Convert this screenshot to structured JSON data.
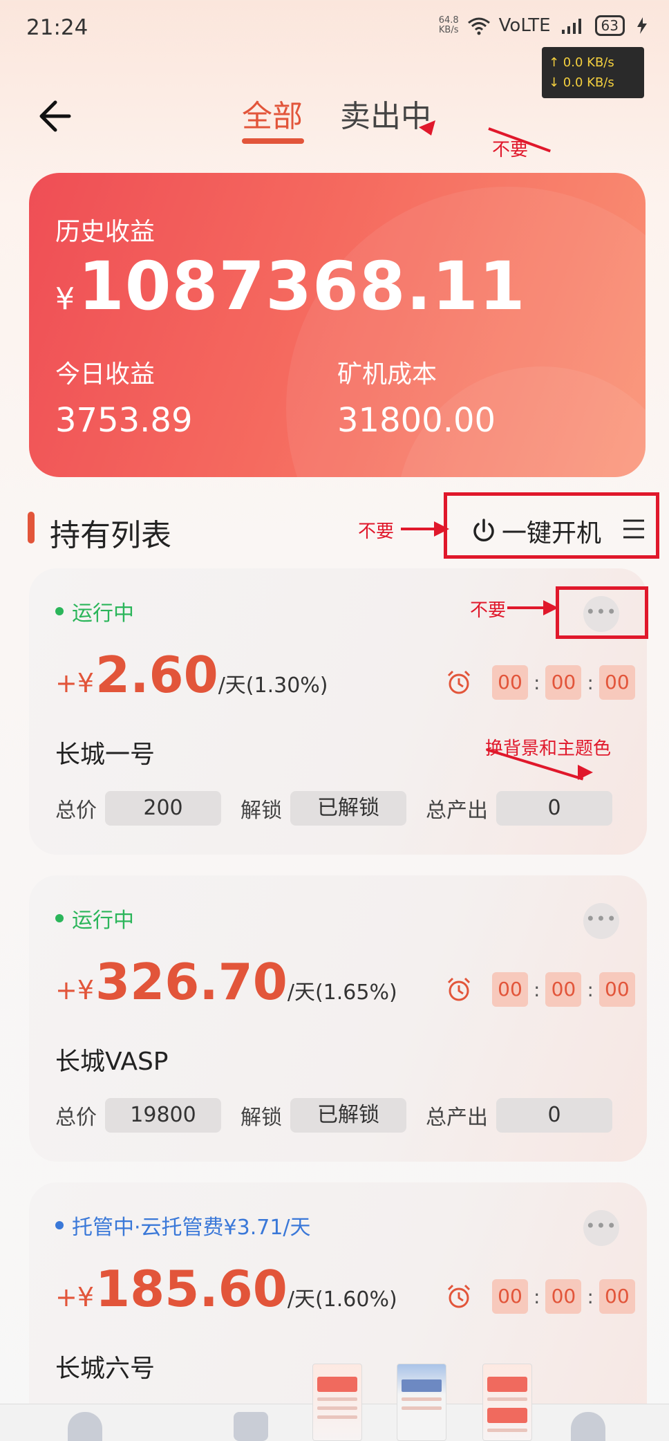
{
  "status_bar": {
    "time": "21:24",
    "speed_value": "64.8",
    "speed_unit": "KB/s",
    "network": "VoLTE",
    "battery": "63",
    "upload": "↑ 0.0 KB/s",
    "download": "↓ 0.0 KB/s"
  },
  "header": {
    "tabs": [
      {
        "label": "全部",
        "active": true
      },
      {
        "label": "卖出中",
        "active": false
      }
    ]
  },
  "summary": {
    "history_label": "历史收益",
    "currency": "¥",
    "history_value": "1087368.11",
    "today_label": "今日收益",
    "today_value": "3753.89",
    "cost_label": "矿机成本",
    "cost_value": "31800.00"
  },
  "list": {
    "title": "持有列表",
    "one_key_label": "一键开机"
  },
  "items": [
    {
      "status": "运行中",
      "status_color": "#2bb55a",
      "sign": "+¥",
      "amount": "2.60",
      "per": "/天(1.30%)",
      "timer": [
        "00",
        "00",
        "00"
      ],
      "name": "长城一号",
      "price_label": "总价",
      "price": "200",
      "unlock_label": "解锁",
      "unlock": "已解锁",
      "output_label": "总产出",
      "output": "0"
    },
    {
      "status": "运行中",
      "status_color": "#2bb55a",
      "sign": "+¥",
      "amount": "326.70",
      "per": "/天(1.65%)",
      "timer": [
        "00",
        "00",
        "00"
      ],
      "name": "长城VASP",
      "price_label": "总价",
      "price": "19800",
      "unlock_label": "解锁",
      "unlock": "已解锁",
      "output_label": "总产出",
      "output": "0"
    },
    {
      "status": "托管中·云托管费¥3.71/天",
      "status_color": "#3a78d8",
      "sign": "+¥",
      "amount": "185.60",
      "per": "/天(1.60%)",
      "timer": [
        "00",
        "00",
        "00"
      ],
      "name": "长城六号"
    }
  ],
  "annotations": {
    "tab_note": "不要",
    "onekey_note": "不要",
    "more_note": "不要",
    "theme_note": "换背景和主题色"
  },
  "colors": {
    "accent": "#e2553a",
    "annotation": "#e0182b",
    "running": "#2bb55a",
    "hosted": "#3a78d8"
  }
}
